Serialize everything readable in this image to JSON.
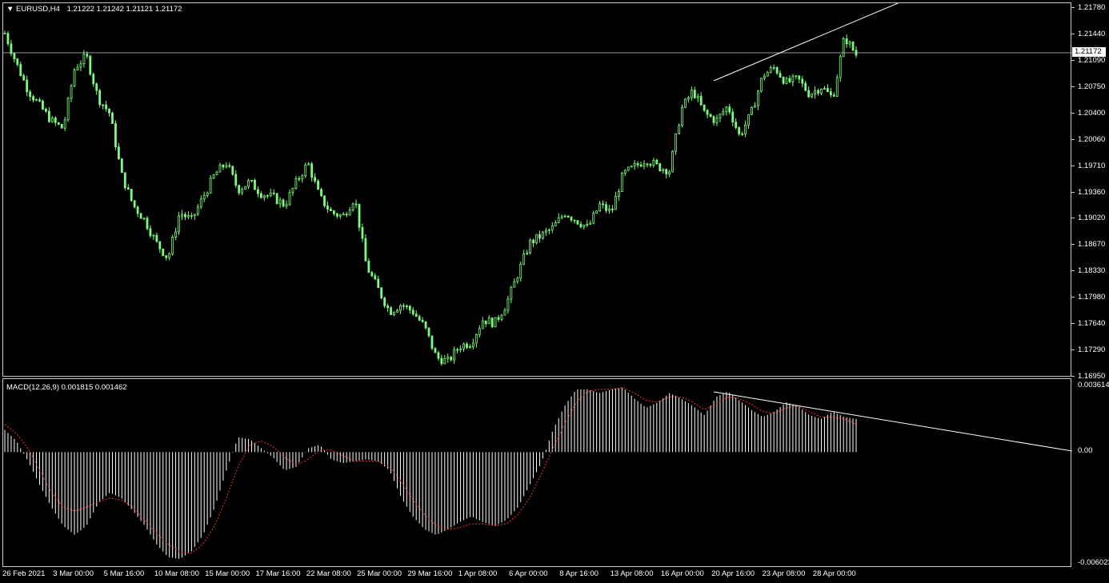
{
  "main": {
    "symbol": "EURUSD,H4",
    "ohlc": "1.21222 1.21242 1.21121 1.21172",
    "price_marker": "1.21172",
    "price_ticks": [
      "1.21780",
      "1.21440",
      "1.21090",
      "1.20750",
      "1.20400",
      "1.20060",
      "1.19710",
      "1.19360",
      "1.19020",
      "1.18670",
      "1.18330",
      "1.17980",
      "1.17640",
      "1.17290",
      "1.16950"
    ]
  },
  "macd": {
    "title": "MACD(12,26,9) 0.001815 0.001462",
    "ticks": [
      "0.003614",
      "0.00",
      "-0.006023"
    ]
  },
  "time_labels": [
    "26 Feb 2021",
    "3 Mar 00:00",
    "5 Mar 16:00",
    "10 Mar 08:00",
    "15 Mar 00:00",
    "17 Mar 16:00",
    "22 Mar 08:00",
    "25 Mar 00:00",
    "29 Mar 16:00",
    "1 Apr 08:00",
    "6 Apr 00:00",
    "8 Apr 16:00",
    "13 Apr 08:00",
    "16 Apr 00:00",
    "20 Apr 16:00",
    "23 Apr 08:00",
    "28 Apr 00:00"
  ],
  "colors": {
    "candle": "#7cfc7c",
    "background": "#000000",
    "grid": "#c8c8c8",
    "signal": "#ff3030",
    "histogram": "#ffffff"
  },
  "chart_data": [
    {
      "type": "line",
      "title": "EURUSD,H4",
      "ylim": [
        1.1695,
        1.2178
      ],
      "close_path": [
        1.2145,
        1.2105,
        1.207,
        1.205,
        1.203,
        1.202,
        1.21,
        1.2115,
        1.206,
        1.204,
        1.196,
        1.192,
        1.19,
        1.187,
        1.185,
        1.191,
        1.19,
        1.193,
        1.196,
        1.1975,
        1.194,
        1.195,
        1.1935,
        1.193,
        1.192,
        1.195,
        1.1975,
        1.193,
        1.191,
        1.1905,
        1.193,
        1.184,
        1.181,
        1.178,
        1.179,
        1.178,
        1.176,
        1.172,
        1.1715,
        1.1735,
        1.174,
        1.177,
        1.1765,
        1.179,
        1.183,
        1.187,
        1.188,
        1.189,
        1.191,
        1.19,
        1.189,
        1.192,
        1.191,
        1.196,
        1.197,
        1.198,
        1.197,
        1.1965,
        1.2045,
        1.207,
        1.204,
        1.203,
        1.205,
        1.201,
        1.204,
        1.209,
        1.21,
        1.208,
        1.2085,
        1.2065,
        1.2075,
        1.206,
        1.214,
        1.2117
      ]
    },
    {
      "type": "bar",
      "title": "MACD(12,26,9)",
      "ylim": [
        -0.006023,
        0.003614
      ],
      "histogram": [
        0.0012,
        0.0006,
        -0.0005,
        -0.0018,
        -0.003,
        -0.004,
        -0.0045,
        -0.004,
        -0.0028,
        -0.0022,
        -0.0025,
        -0.0032,
        -0.004,
        -0.005,
        -0.0057,
        -0.0058,
        -0.0054,
        -0.0045,
        -0.003,
        -0.001,
        0.0008,
        0.0007,
        0.0002,
        -0.0003,
        -0.001,
        -0.0008,
        0.0002,
        0.0004,
        -0.0004,
        -0.0006,
        -0.0005,
        -0.0004,
        -0.0005,
        -0.001,
        -0.0025,
        -0.0035,
        -0.0042,
        -0.0045,
        -0.0042,
        -0.0038,
        -0.0035,
        -0.0038,
        -0.004,
        -0.0037,
        -0.003,
        -0.0018,
        -0.0006,
        0.0012,
        0.0025,
        0.0034,
        0.0034,
        0.0032,
        0.0034,
        0.0035,
        0.0029,
        0.0024,
        0.0027,
        0.0032,
        0.0029,
        0.0025,
        0.002,
        0.003,
        0.0033,
        0.0028,
        0.0023,
        0.0019,
        0.0022,
        0.0027,
        0.0025,
        0.002,
        0.0018,
        0.0022,
        0.0019,
        0.0018
      ],
      "signal": [
        0.0015,
        0.001,
        0.0002,
        -0.001,
        -0.0022,
        -0.003,
        -0.0032,
        -0.003,
        -0.0027,
        -0.0025,
        -0.0026,
        -0.003,
        -0.0037,
        -0.0044,
        -0.005,
        -0.0054,
        -0.0055,
        -0.005,
        -0.004,
        -0.0025,
        -0.0008,
        0.0004,
        0.0006,
        0.0003,
        -0.0003,
        -0.0007,
        -0.0004,
        0.0001,
        0.0001,
        -0.0002,
        -0.0005,
        -0.0005,
        -0.0005,
        -0.0008,
        -0.0016,
        -0.0026,
        -0.0034,
        -0.004,
        -0.0042,
        -0.0041,
        -0.0039,
        -0.0039,
        -0.004,
        -0.0039,
        -0.0034,
        -0.0025,
        -0.0012,
        0.0002,
        0.0015,
        0.0027,
        0.0033,
        0.0034,
        0.0034,
        0.0035,
        0.0032,
        0.0028,
        0.0027,
        0.003,
        0.003,
        0.0027,
        0.0023,
        0.0026,
        0.003,
        0.0029,
        0.0026,
        0.0022,
        0.0021,
        0.0024,
        0.0025,
        0.0022,
        0.0019,
        0.0019,
        0.0018,
        0.0015
      ]
    }
  ]
}
